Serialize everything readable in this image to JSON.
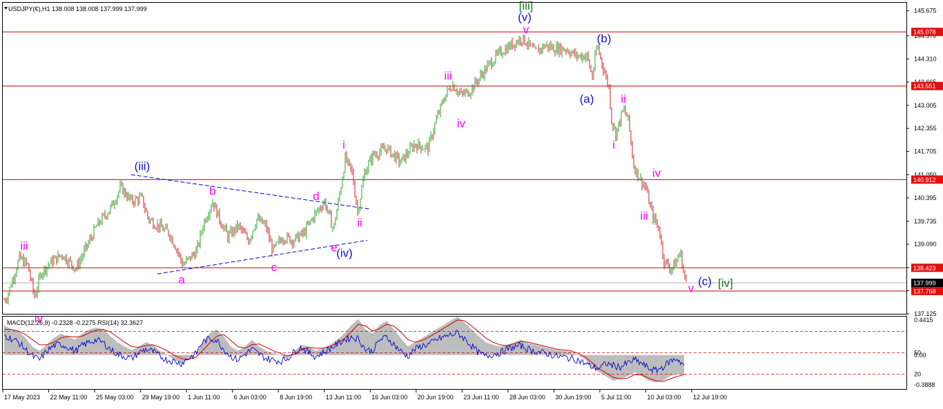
{
  "header": {
    "symbol_line": "USDJPY(€),H1  138.008 138.008 137.999 137.999"
  },
  "indicator_header": "MACD(12,26,9) -0.2328 -0.2275 RSI(14) 32.3627",
  "colors": {
    "background": "#ffffff",
    "bull_candle": "#22a622",
    "bear_candle": "#cc2222",
    "hline": "#cc0000",
    "price_label_bg": "#e01010",
    "current_label_bg": "#000000",
    "wave_magenta": "#ff00ff",
    "wave_blue": "#1010d0",
    "wave_green": "#1a7a1a",
    "trendline": "#0000cc",
    "macd_hist": "#bdbdbd",
    "macd_signal": "#cc0000",
    "rsi_line": "#0000cc"
  },
  "chart_data": [
    {
      "type": "candlestick",
      "title": "USDJPY(€),H1",
      "ylim": [
        137.125,
        145.9
      ],
      "price_ticks": [
        "145.675",
        "144.970",
        "144.310",
        "143.665",
        "143.005",
        "142.355",
        "141.705",
        "141.050",
        "140.395",
        "139.735",
        "139.090",
        "138.430",
        "137.780",
        "137.125"
      ],
      "x_tick_labels": [
        "17 May 2023",
        "22 May 11:00",
        "25 May 03:00",
        "29 May 19:00",
        "1 Jun 11:00",
        "6 Jun 03:00",
        "8 Jun 19:00",
        "13 Jun 11:00",
        "16 Jun 03:00",
        "20 Jun 19:00",
        "23 Jun 11:00",
        "28 Jun 03:00",
        "30 Jun 19:00",
        "5 Jul 11:00",
        "10 Jul 03:00",
        "12 Jul 19:00"
      ],
      "horizontal_levels": [
        {
          "value": 145.078,
          "label": "145.078"
        },
        {
          "value": 143.551,
          "label": "143.551"
        },
        {
          "value": 140.912,
          "label": "140.912"
        },
        {
          "value": 138.423,
          "label": "138.423"
        },
        {
          "value": 137.768,
          "label": "137.768"
        }
      ],
      "current_price": {
        "value": 137.999,
        "label": "137.999"
      },
      "price_path": [
        [
          0,
          137.4
        ],
        [
          10,
          137.6
        ],
        [
          20,
          138.2
        ],
        [
          28,
          138.7
        ],
        [
          40,
          138.5
        ],
        [
          50,
          137.6
        ],
        [
          60,
          138.3
        ],
        [
          75,
          138.6
        ],
        [
          90,
          138.8
        ],
        [
          110,
          138.4
        ],
        [
          125,
          139.0
        ],
        [
          140,
          139.6
        ],
        [
          160,
          140.1
        ],
        [
          175,
          140.7
        ],
        [
          190,
          140.3
        ],
        [
          205,
          140.4
        ],
        [
          215,
          139.8
        ],
        [
          230,
          139.6
        ],
        [
          245,
          139.4
        ],
        [
          255,
          139.0
        ],
        [
          265,
          138.5
        ],
        [
          275,
          138.7
        ],
        [
          285,
          138.9
        ],
        [
          295,
          139.7
        ],
        [
          308,
          140.3
        ],
        [
          318,
          139.8
        ],
        [
          330,
          139.3
        ],
        [
          345,
          139.6
        ],
        [
          360,
          139.2
        ],
        [
          372,
          139.8
        ],
        [
          385,
          139.6
        ],
        [
          395,
          138.9
        ],
        [
          410,
          139.3
        ],
        [
          425,
          139.2
        ],
        [
          440,
          139.4
        ],
        [
          455,
          139.9
        ],
        [
          470,
          140.3
        ],
        [
          483,
          139.5
        ],
        [
          492,
          140.5
        ],
        [
          500,
          141.5
        ],
        [
          510,
          141.1
        ],
        [
          518,
          140.0
        ],
        [
          528,
          141.1
        ],
        [
          540,
          141.6
        ],
        [
          560,
          141.8
        ],
        [
          580,
          141.4
        ],
        [
          600,
          141.9
        ],
        [
          620,
          141.8
        ],
        [
          632,
          142.6
        ],
        [
          645,
          143.3
        ],
        [
          655,
          143.6
        ],
        [
          668,
          143.3
        ],
        [
          680,
          143.4
        ],
        [
          695,
          143.8
        ],
        [
          710,
          144.2
        ],
        [
          725,
          144.5
        ],
        [
          740,
          144.7
        ],
        [
          755,
          144.9
        ],
        [
          762,
          144.8
        ],
        [
          775,
          144.5
        ],
        [
          790,
          144.7
        ],
        [
          805,
          144.6
        ],
        [
          820,
          144.6
        ],
        [
          835,
          144.4
        ],
        [
          850,
          144.4
        ],
        [
          858,
          143.8
        ],
        [
          865,
          144.7
        ],
        [
          872,
          144.2
        ],
        [
          882,
          143.5
        ],
        [
          886,
          142.6
        ],
        [
          892,
          142.2
        ],
        [
          903,
          142.9
        ],
        [
          910,
          142.6
        ],
        [
          918,
          141.3
        ],
        [
          928,
          140.9
        ],
        [
          935,
          140.7
        ],
        [
          945,
          139.9
        ],
        [
          955,
          139.5
        ],
        [
          962,
          138.6
        ],
        [
          972,
          138.4
        ],
        [
          980,
          138.6
        ],
        [
          985,
          138.9
        ],
        [
          991,
          138.2
        ],
        [
          995,
          138.0
        ]
      ],
      "wave_labels": [
        {
          "text": "[iii]",
          "price": 145.82,
          "xpos": 762,
          "color": "green"
        },
        {
          "text": "(v)",
          "price": 145.5,
          "xpos": 760,
          "color": "blue"
        },
        {
          "text": "v",
          "price": 145.15,
          "xpos": 762,
          "color": "magenta"
        },
        {
          "text": "(b)",
          "price": 144.9,
          "xpos": 875,
          "color": "blue"
        },
        {
          "text": "iii",
          "price": 143.85,
          "xpos": 649,
          "color": "magenta"
        },
        {
          "text": "(a)",
          "price": 143.2,
          "xpos": 850,
          "color": "blue"
        },
        {
          "text": "ii",
          "price": 143.2,
          "xpos": 903,
          "color": "magenta"
        },
        {
          "text": "iv",
          "price": 142.5,
          "xpos": 668,
          "color": "magenta"
        },
        {
          "text": "i",
          "price": 141.9,
          "xpos": 889,
          "color": "magenta"
        },
        {
          "text": "i",
          "price": 141.9,
          "xpos": 498,
          "color": "magenta"
        },
        {
          "text": "(iii)",
          "price": 141.3,
          "xpos": 206,
          "color": "blue"
        },
        {
          "text": "iv",
          "price": 141.1,
          "xpos": 951,
          "color": "magenta"
        },
        {
          "text": "b",
          "price": 140.6,
          "xpos": 308,
          "color": "magenta"
        },
        {
          "text": "d",
          "price": 140.45,
          "xpos": 458,
          "color": "magenta"
        },
        {
          "text": "iii",
          "price": 139.9,
          "xpos": 933,
          "color": "magenta"
        },
        {
          "text": "ii",
          "price": 139.7,
          "xpos": 521,
          "color": "magenta"
        },
        {
          "text": "iii",
          "price": 139.05,
          "xpos": 35,
          "color": "magenta"
        },
        {
          "text": "e",
          "price": 139.0,
          "xpos": 484,
          "color": "magenta"
        },
        {
          "text": "(iv)",
          "price": 138.85,
          "xpos": 499,
          "color": "blue"
        },
        {
          "text": "c",
          "price": 138.45,
          "xpos": 397,
          "color": "magenta"
        },
        {
          "text": "a",
          "price": 138.1,
          "xpos": 263,
          "color": "magenta"
        },
        {
          "text": "(c)",
          "price": 138.05,
          "xpos": 1021,
          "color": "blue"
        },
        {
          "text": "[iv]",
          "price": 138.0,
          "xpos": 1051,
          "color": "green"
        },
        {
          "text": "v",
          "price": 137.85,
          "xpos": 1001,
          "color": "magenta"
        },
        {
          "text": "iv",
          "price": 137.0,
          "xpos": 56,
          "color": "magenta"
        }
      ],
      "trendlines": [
        {
          "from": [
            190,
            141.05
          ],
          "to": [
            536,
            140.08
          ]
        },
        {
          "from": [
            228,
            138.25
          ],
          "to": [
            532,
            139.2
          ]
        }
      ]
    },
    {
      "type": "line",
      "title": "MACD(12,26,9) -0.2328 -0.2275 RSI(14) 32.3627",
      "y_tick_labels": [
        "0.4415",
        "0.00",
        "50",
        "20",
        "-0.3888"
      ],
      "series": [
        {
          "values": [
            0.35,
            0.3,
            0.28,
            0.2,
            0.1,
            0.05,
            0.12,
            0.2,
            0.25,
            0.22,
            0.18,
            0.25,
            0.3,
            0.32,
            0.3,
            0.22,
            0.15,
            0.1,
            0.06,
            0.1,
            0.15,
            0.12,
            0.05,
            0.0,
            -0.05,
            -0.1,
            -0.05,
            0.0,
            0.15,
            0.25,
            0.3,
            0.22,
            0.1,
            0.05,
            0.1,
            0.18,
            0.1,
            0.05,
            0.02,
            0.0,
            -0.05,
            0.05,
            0.12,
            0.1,
            0.05,
            0.08,
            0.12,
            0.18,
            0.25,
            0.35,
            0.42,
            0.3,
            0.25,
            0.35,
            0.4,
            0.3,
            0.2,
            0.1,
            0.15,
            0.2,
            0.25,
            0.3,
            0.35,
            0.4,
            0.45,
            0.38,
            0.3,
            0.22,
            0.15,
            0.12,
            0.1,
            0.12,
            0.15,
            0.18,
            0.14,
            0.12,
            0.1,
            0.08,
            0.06,
            0.05,
            0.04,
            0.0,
            -0.05,
            -0.15,
            -0.2,
            -0.25,
            -0.3,
            -0.28,
            -0.25,
            -0.2,
            -0.25,
            -0.3,
            -0.32,
            -0.3,
            -0.25,
            -0.22,
            -0.23
          ]
        },
        {
          "values": [
            0.3,
            0.3,
            0.28,
            0.24,
            0.18,
            0.12,
            0.12,
            0.15,
            0.2,
            0.22,
            0.21,
            0.22,
            0.26,
            0.29,
            0.3,
            0.27,
            0.21,
            0.15,
            0.1,
            0.09,
            0.11,
            0.12,
            0.09,
            0.05,
            0.0,
            -0.04,
            -0.05,
            -0.03,
            0.05,
            0.14,
            0.22,
            0.24,
            0.17,
            0.1,
            0.08,
            0.12,
            0.13,
            0.09,
            0.05,
            0.02,
            -0.01,
            0.01,
            0.07,
            0.09,
            0.08,
            0.08,
            0.1,
            0.14,
            0.19,
            0.27,
            0.36,
            0.34,
            0.28,
            0.31,
            0.36,
            0.34,
            0.27,
            0.18,
            0.15,
            0.17,
            0.21,
            0.26,
            0.31,
            0.36,
            0.41,
            0.4,
            0.34,
            0.27,
            0.2,
            0.15,
            0.12,
            0.11,
            0.13,
            0.16,
            0.15,
            0.13,
            0.11,
            0.09,
            0.07,
            0.06,
            0.05,
            0.02,
            -0.02,
            -0.09,
            -0.16,
            -0.21,
            -0.26,
            -0.28,
            -0.27,
            -0.23,
            -0.23,
            -0.27,
            -0.3,
            -0.31,
            -0.28,
            -0.25,
            -0.23
          ]
        },
        {
          "name": "RSI(14)",
          "values": [
            75,
            70,
            65,
            55,
            45,
            40,
            52,
            60,
            62,
            58,
            52,
            60,
            65,
            68,
            64,
            55,
            48,
            45,
            42,
            50,
            55,
            52,
            45,
            40,
            38,
            35,
            42,
            48,
            65,
            70,
            68,
            55,
            45,
            40,
            48,
            55,
            48,
            42,
            40,
            38,
            42,
            52,
            58,
            50,
            45,
            50,
            56,
            62,
            68,
            72,
            70,
            55,
            52,
            68,
            72,
            62,
            52,
            45,
            55,
            60,
            62,
            68,
            72,
            75,
            78,
            70,
            60,
            50,
            45,
            48,
            50,
            55,
            58,
            60,
            55,
            52,
            50,
            48,
            45,
            44,
            42,
            40,
            35,
            30,
            28,
            35,
            32,
            30,
            35,
            40,
            35,
            28,
            25,
            30,
            38,
            42,
            32
          ]
        }
      ]
    }
  ]
}
